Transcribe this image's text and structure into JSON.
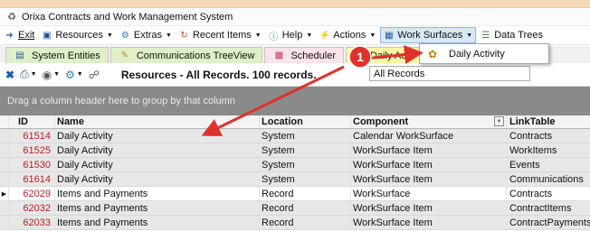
{
  "window": {
    "title": "Orixa Contracts and Work Management System"
  },
  "menu": [
    {
      "label": "Exit",
      "icon": "exit-icon",
      "caret": false
    },
    {
      "label": "Resources",
      "icon": "database-icon",
      "caret": true
    },
    {
      "label": "Extras",
      "icon": "extras-icon",
      "caret": true
    },
    {
      "label": "Recent Items",
      "icon": "recent-icon",
      "caret": true
    },
    {
      "label": "Help",
      "icon": "help-icon",
      "caret": true
    },
    {
      "label": "Actions",
      "icon": "lightning-icon",
      "caret": true
    },
    {
      "label": "Work Surfaces",
      "icon": "grid-icon",
      "caret": true,
      "active": true
    },
    {
      "label": "Data Trees",
      "icon": "tree-icon",
      "caret": false
    }
  ],
  "dropdown": {
    "item_label": "Daily Activity",
    "item_icon": "daily-activity-icon"
  },
  "tabs": [
    {
      "label": "System Entities",
      "icon": "entities-icon"
    },
    {
      "label": "Communications TreeView",
      "icon": "pencil-icon"
    },
    {
      "label": "Scheduler",
      "icon": "scheduler-icon"
    },
    {
      "label": "Daily Activ",
      "icon": "activity-icon"
    }
  ],
  "toolbar": {
    "records_label": "Resources - All Records. 100 records.",
    "filter_value": "All Records"
  },
  "group_band": {
    "text": "Drag a column header here to group by that column"
  },
  "grid": {
    "columns": {
      "id": "ID",
      "name": "Name",
      "location": "Location",
      "component": "Component",
      "linktable": "LinkTable"
    },
    "rows": [
      {
        "id": "61514",
        "name": "Daily Activity",
        "location": "System",
        "component": "Calendar WorkSurface",
        "linktable": "Contracts"
      },
      {
        "id": "61525",
        "name": "Daily Activity",
        "location": "System",
        "component": "WorkSurface Item",
        "linktable": "WorkItems"
      },
      {
        "id": "61530",
        "name": "Daily Activity",
        "location": "System",
        "component": "WorkSurface Item",
        "linktable": "Events"
      },
      {
        "id": "61614",
        "name": "Daily Activity",
        "location": "System",
        "component": "WorkSurface Item",
        "linktable": "Communications"
      },
      {
        "id": "62029",
        "name": "Items and Payments",
        "location": "Record",
        "component": "WorkSurface",
        "linktable": "Contracts"
      },
      {
        "id": "62032",
        "name": "Items and Payments",
        "location": "Record",
        "component": "WorkSurface Item",
        "linktable": "ContractItems"
      },
      {
        "id": "62033",
        "name": "Items and Payments",
        "location": "Record",
        "component": "WorkSurface Item",
        "linktable": "ContractPayments"
      }
    ]
  },
  "annotation": {
    "badge": "1"
  },
  "colors": {
    "accent_red": "#e0322c",
    "selected_tab": "#fff6a6",
    "group_band": "#8a8a8a",
    "id_text": "#b32020"
  }
}
